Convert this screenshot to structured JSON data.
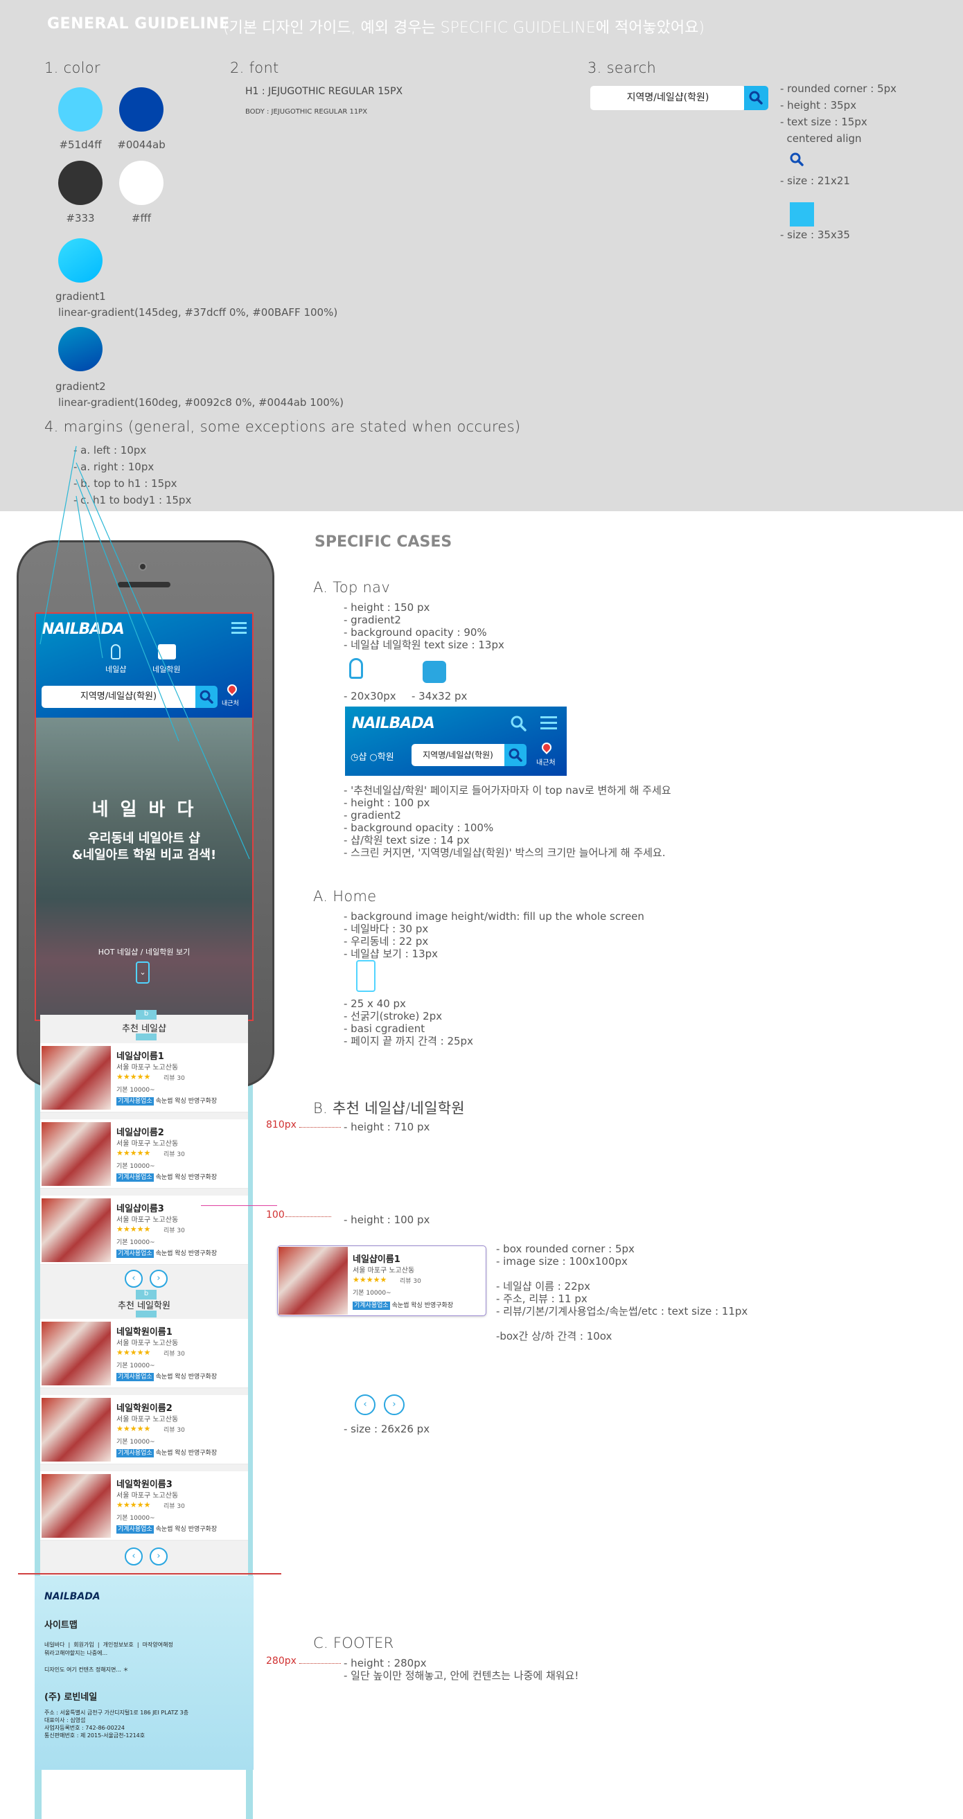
{
  "header": {
    "title": "GENERAL GUIDELINE",
    "subtitle": "(기본 디자인 가이드, 예외 경우는 SPECIFIC GUIDELINE에 적어놓았어요)"
  },
  "color": {
    "heading": "1. color",
    "swatches": [
      {
        "label": "#51d4ff",
        "hex": "#51d4ff"
      },
      {
        "label": "#0044ab",
        "hex": "#0044ab"
      },
      {
        "label": "#333",
        "hex": "#333333"
      },
      {
        "label": "#fff",
        "hex": "#ffffff"
      }
    ],
    "gradient1_label": "gradient1",
    "gradient1_css": "linear-gradient(145deg, #37dcff 0%, #00BAFF 100%)",
    "gradient2_label": "gradient2",
    "gradient2_css": "linear-gradient(160deg, #0092c8 0%, #0044ab 100%)"
  },
  "font": {
    "heading": "2. font",
    "h1": "H1 : JEJUGOTHIC REGULAR 15PX",
    "body": "BODY : JEJUGOTHIC REGULAR 11PX"
  },
  "search": {
    "heading": "3. search",
    "placeholder": "지역명/네일샵(학원)",
    "specs": [
      "- rounded corner : 5px",
      "- height : 35px",
      "- text size : 15px",
      "centered align"
    ],
    "icon_size": "- size : 21x21",
    "button_size": "- size : 35x35"
  },
  "margins": {
    "heading": "4. margins (general, some exceptions are stated when occures)",
    "items": [
      "- a. left : 10px",
      "- a. right : 10px",
      "- b. top to h1 : 15px",
      "- c. h1 to body1 : 15px"
    ]
  },
  "phone": {
    "logo": "NAILBADA",
    "tab_shop": "네일샵",
    "tab_academy": "네일학원",
    "search_text": "지역명/네일샵(학원)",
    "nearby": "내근처",
    "hero_title": "네 일 바 다",
    "hero_line1": "우리동네 네일아트 샵",
    "hero_line2": "&네일아트 학원 비교 검색!",
    "hot_text": "HOT 네일샵 / 네일학원 보기",
    "marker_b": "b",
    "marker_c": "c",
    "section1": "추천 네일샵",
    "section2": "추천 네일학원",
    "shops": [
      {
        "name": "네일샵이름1",
        "addr": "서울 마포구 노고산동",
        "stars": "★★★★★",
        "review": "리뷰 30",
        "base": "기본 10000~",
        "tags": [
          "기계사용업소",
          "속눈썹",
          "왁싱",
          "반영구화장"
        ]
      },
      {
        "name": "네일샵이름2",
        "addr": "서울 마포구 노고산동",
        "stars": "★★★★★",
        "review": "리뷰 30",
        "base": "기본 10000~",
        "tags": [
          "기계사용업소",
          "속눈썹",
          "왁싱",
          "반영구화장"
        ]
      },
      {
        "name": "네일샵이름3",
        "addr": "서울 마포구 노고산동",
        "stars": "★★★★★",
        "review": "리뷰 30",
        "base": "기본 10000~",
        "tags": [
          "기계사용업소",
          "속눈썹",
          "왁싱",
          "반영구화장"
        ]
      }
    ],
    "academies": [
      {
        "name": "네일학원이름1",
        "addr": "서울 마포구 노고산동",
        "stars": "★★★★★",
        "review": "리뷰 30",
        "base": "기본 10000~",
        "tags": [
          "기계사용업소",
          "속눈썹",
          "왁싱",
          "반영구화장"
        ]
      },
      {
        "name": "네일학원이름2",
        "addr": "서울 마포구 노고산동",
        "stars": "★★★★★",
        "review": "리뷰 30",
        "base": "기본 10000~",
        "tags": [
          "기계사용업소",
          "속눈썹",
          "왁싱",
          "반영구화장"
        ]
      },
      {
        "name": "네일학원이름3",
        "addr": "서울 마포구 노고산동",
        "stars": "★★★★★",
        "review": "리뷰 30",
        "base": "기본 10000~",
        "tags": [
          "기계사용업소",
          "속눈썹",
          "왁싱",
          "반영구화장"
        ]
      }
    ],
    "footer_logo": "NAILBADA",
    "footer_sitemap": "사이트맵",
    "footer_links": "네일바다  |  회원가입  |  개인정보보호  |  마작양여해정",
    "footer_links2": "뭐라고해야할지는 나중에...",
    "footer_note": "디자인도 여기 컨텐츠 정해지면... ＊",
    "footer_company": "(주) 로빈네일",
    "footer_info": [
      "주소 : 서울특별시 금천구 가산디지털1로 186 JEI PLATZ 3층",
      "대표이사 : 심영섭",
      "사업자등록번호 : 742-86-00224",
      "통신판매번호 : 제 2015-서울금천-1214호"
    ]
  },
  "specific": {
    "title": "SPECIFIC CASES",
    "topnav_heading": "A. Top nav",
    "topnav_specs": [
      "- height : 150 px",
      "- gradient2",
      "- background opacity : 90%",
      "- 네일샵 네일학원 text size : 13px"
    ],
    "icon1_size": "- 20x30px",
    "icon2_size": "- 34x32 px",
    "nav2_logo": "NAILBADA",
    "nav2_radio": "◷샵 ○학원",
    "nav2_search": "지역명/네일샵(학원)",
    "nav2_nearby": "내근처",
    "topnav_specs2": [
      "- '추천네일샵/학원' 페이지로 들어가자마자 이 top nav로 변하게 해 주세요",
      "- height : 100 px",
      "- gradient2",
      "- background opacity : 100%",
      "- 샵/학원 text size : 14 px",
      "- 스크린 커지면, '지역명/네일샵(학원)' 박스의 크기만 늘어나게 해 주세요."
    ],
    "home_heading": "A. Home",
    "home_specs": [
      "- background image height/width: fill up the whole screen",
      "- 네일바다 : 30 px",
      "- 우리동네 : 22 px",
      "- 네일샵 보기 : 13px"
    ],
    "home_specs2": [
      "- 25 x 40 px",
      "- 선굵기(stroke) 2px",
      "- basi cgradient",
      "- 페이지 끝 까지 간격 : 25px"
    ],
    "rec_heading": "B. 추천 네일샵/네일학원",
    "rec_px": "810px",
    "rec_height": "- height : 710 px",
    "item_px": "100",
    "item_height": "- height : 100 px",
    "sample": {
      "name": "네일샵이름1",
      "addr": "서울 마포구 노고산동",
      "stars": "★★★★★",
      "review": "리뷰 30",
      "base": "기본 10000~",
      "tags": [
        "기계사용업소",
        "속눈썹",
        "왁싱",
        "반영구화장"
      ]
    },
    "box_specs": [
      "- box rounded corner : 5px",
      "- image size : 100x100px",
      "",
      "- 네일샵 이름 : 22px",
      "- 주소, 리뷰 : 11 px",
      "- 리뷰/기본/기계사용업소/속눈썹/etc : text size : 11px",
      "",
      "-box간 상/하 간격 : 10ox"
    ],
    "arrow_size": "- size : 26x26 px",
    "footer_heading": "C. FOOTER",
    "footer_px": "280px",
    "footer_specs": [
      "- height : 280px",
      "- 일단 높이만 정해놓고, 안에 컨텐츠는 나중에 채워요!"
    ]
  }
}
